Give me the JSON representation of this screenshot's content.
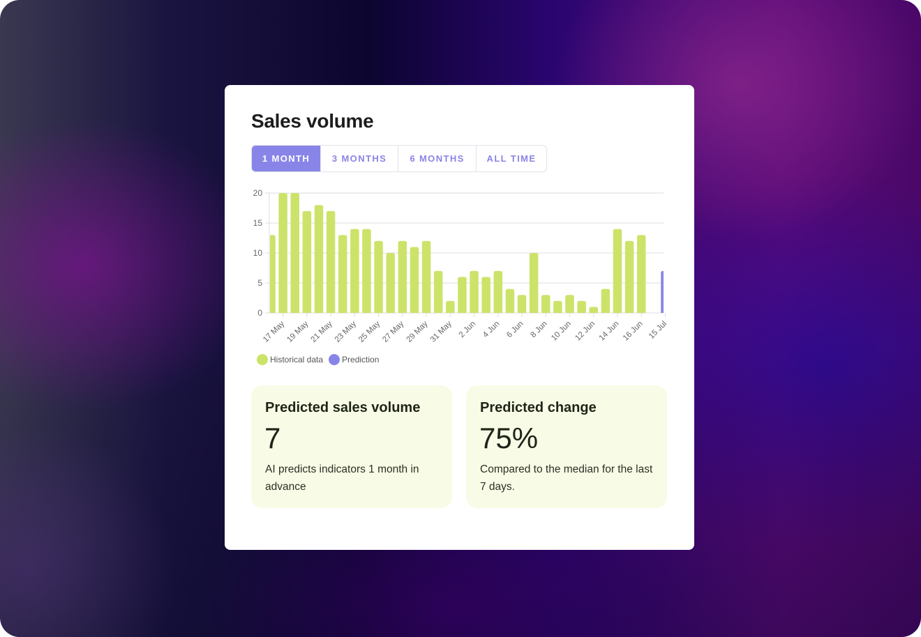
{
  "card": {
    "title": "Sales volume",
    "tabs": [
      {
        "label": "1 MONTH",
        "active": true
      },
      {
        "label": "3 MONTHS",
        "active": false
      },
      {
        "label": "6 MONTHS",
        "active": false
      },
      {
        "label": "ALL TIME",
        "active": false
      }
    ]
  },
  "colors": {
    "historical": "#cce36a",
    "prediction": "#8985e8",
    "grid": "#dcdcdc",
    "axis_text": "#666666"
  },
  "legend": {
    "historical_label": "Historical data",
    "prediction_label": "Prediction"
  },
  "stats": [
    {
      "title": "Predicted sales volume",
      "value": "7",
      "description": "AI predicts indicators 1 month in advance"
    },
    {
      "title": "Predicted change",
      "value": "75%",
      "description": "Compared to the median for the last 7 days."
    }
  ],
  "chart_data": {
    "type": "bar",
    "title": "Sales volume",
    "xlabel": "",
    "ylabel": "",
    "ylim": [
      0,
      20
    ],
    "yticks": [
      0,
      5,
      10,
      15,
      20
    ],
    "grid": true,
    "legend_position": "bottom-left",
    "x_tick_labels": [
      "17 May",
      "19 May",
      "21 May",
      "23 May",
      "25 May",
      "27 May",
      "29 May",
      "31 May",
      "2 Jun",
      "4 Jun",
      "6 Jun",
      "8 Jun",
      "10 Jun",
      "12 Jun",
      "14 Jun",
      "16 Jun",
      "15 Jul"
    ],
    "series": [
      {
        "name": "Historical data",
        "categories": [
          "16 May",
          "17 May",
          "18 May",
          "19 May",
          "20 May",
          "21 May",
          "22 May",
          "23 May",
          "24 May",
          "25 May",
          "26 May",
          "27 May",
          "28 May",
          "29 May",
          "30 May",
          "31 May",
          "1 Jun",
          "2 Jun",
          "3 Jun",
          "4 Jun",
          "5 Jun",
          "6 Jun",
          "7 Jun",
          "8 Jun",
          "9 Jun",
          "10 Jun",
          "11 Jun",
          "12 Jun",
          "13 Jun",
          "14 Jun",
          "15 Jun",
          "16 Jun"
        ],
        "values": [
          13,
          20,
          20,
          17,
          18,
          17,
          13,
          14,
          14,
          12,
          10,
          12,
          11,
          12,
          7,
          2,
          6,
          7,
          6,
          7,
          4,
          3,
          10,
          3,
          2,
          3,
          2,
          1,
          4,
          14,
          12,
          13
        ]
      },
      {
        "name": "Prediction",
        "categories": [
          "15 Jul"
        ],
        "values": [
          7
        ]
      }
    ]
  }
}
